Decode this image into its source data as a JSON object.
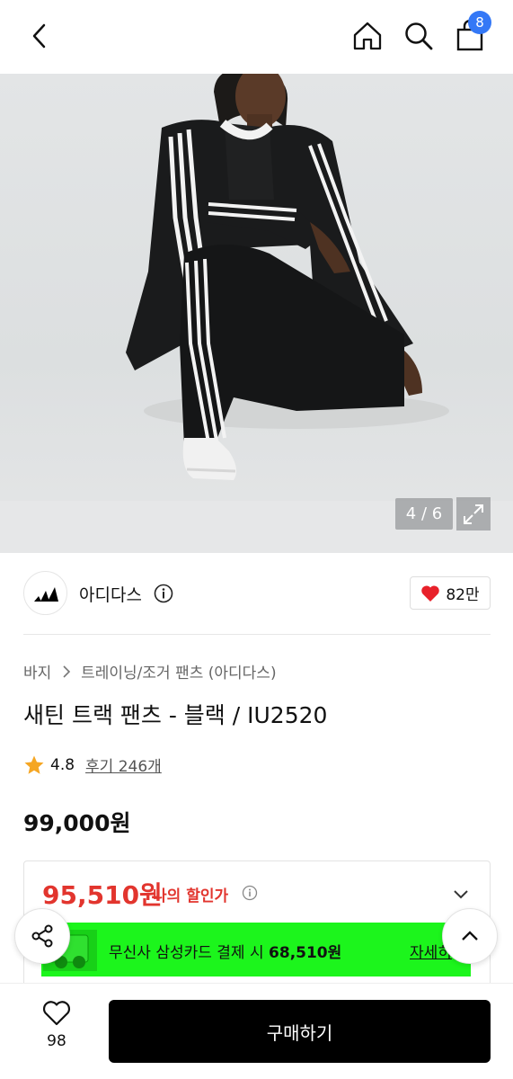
{
  "header": {
    "cart_count": "8",
    "icons": {
      "back": "back-arrow-icon",
      "home": "home-icon",
      "search": "search-icon",
      "cart": "shopping-bag-icon"
    }
  },
  "gallery": {
    "counter": "4 / 6",
    "icons": {
      "expand": "expand-icon"
    }
  },
  "brand": {
    "name": "아디다스",
    "likes": "82만",
    "icons": {
      "logo": "adidas-logo",
      "info": "info-icon",
      "like": "heart-icon"
    }
  },
  "product": {
    "breadcrumb": [
      "바지",
      "트레이닝/조거 팬츠 (아디다스)"
    ],
    "title": "새틴 트랙 팬츠 - 블랙 / IU2520",
    "rating": "4.8",
    "reviews": "후기 246개",
    "price": "99,000원"
  },
  "discount": {
    "price": "95,510원",
    "label": "나의 할인가",
    "promo_text": "무신사 삼성카드 결제 시",
    "promo_price": "68,510원",
    "promo_link": "자세히"
  },
  "bottom_bar": {
    "wish_count": "98",
    "buy_label": "구매하기"
  },
  "colors": {
    "accent_red": "#e2352e",
    "badge_blue": "#3478f6",
    "promo_green": "#1cf51c",
    "star": "#f5a623"
  }
}
